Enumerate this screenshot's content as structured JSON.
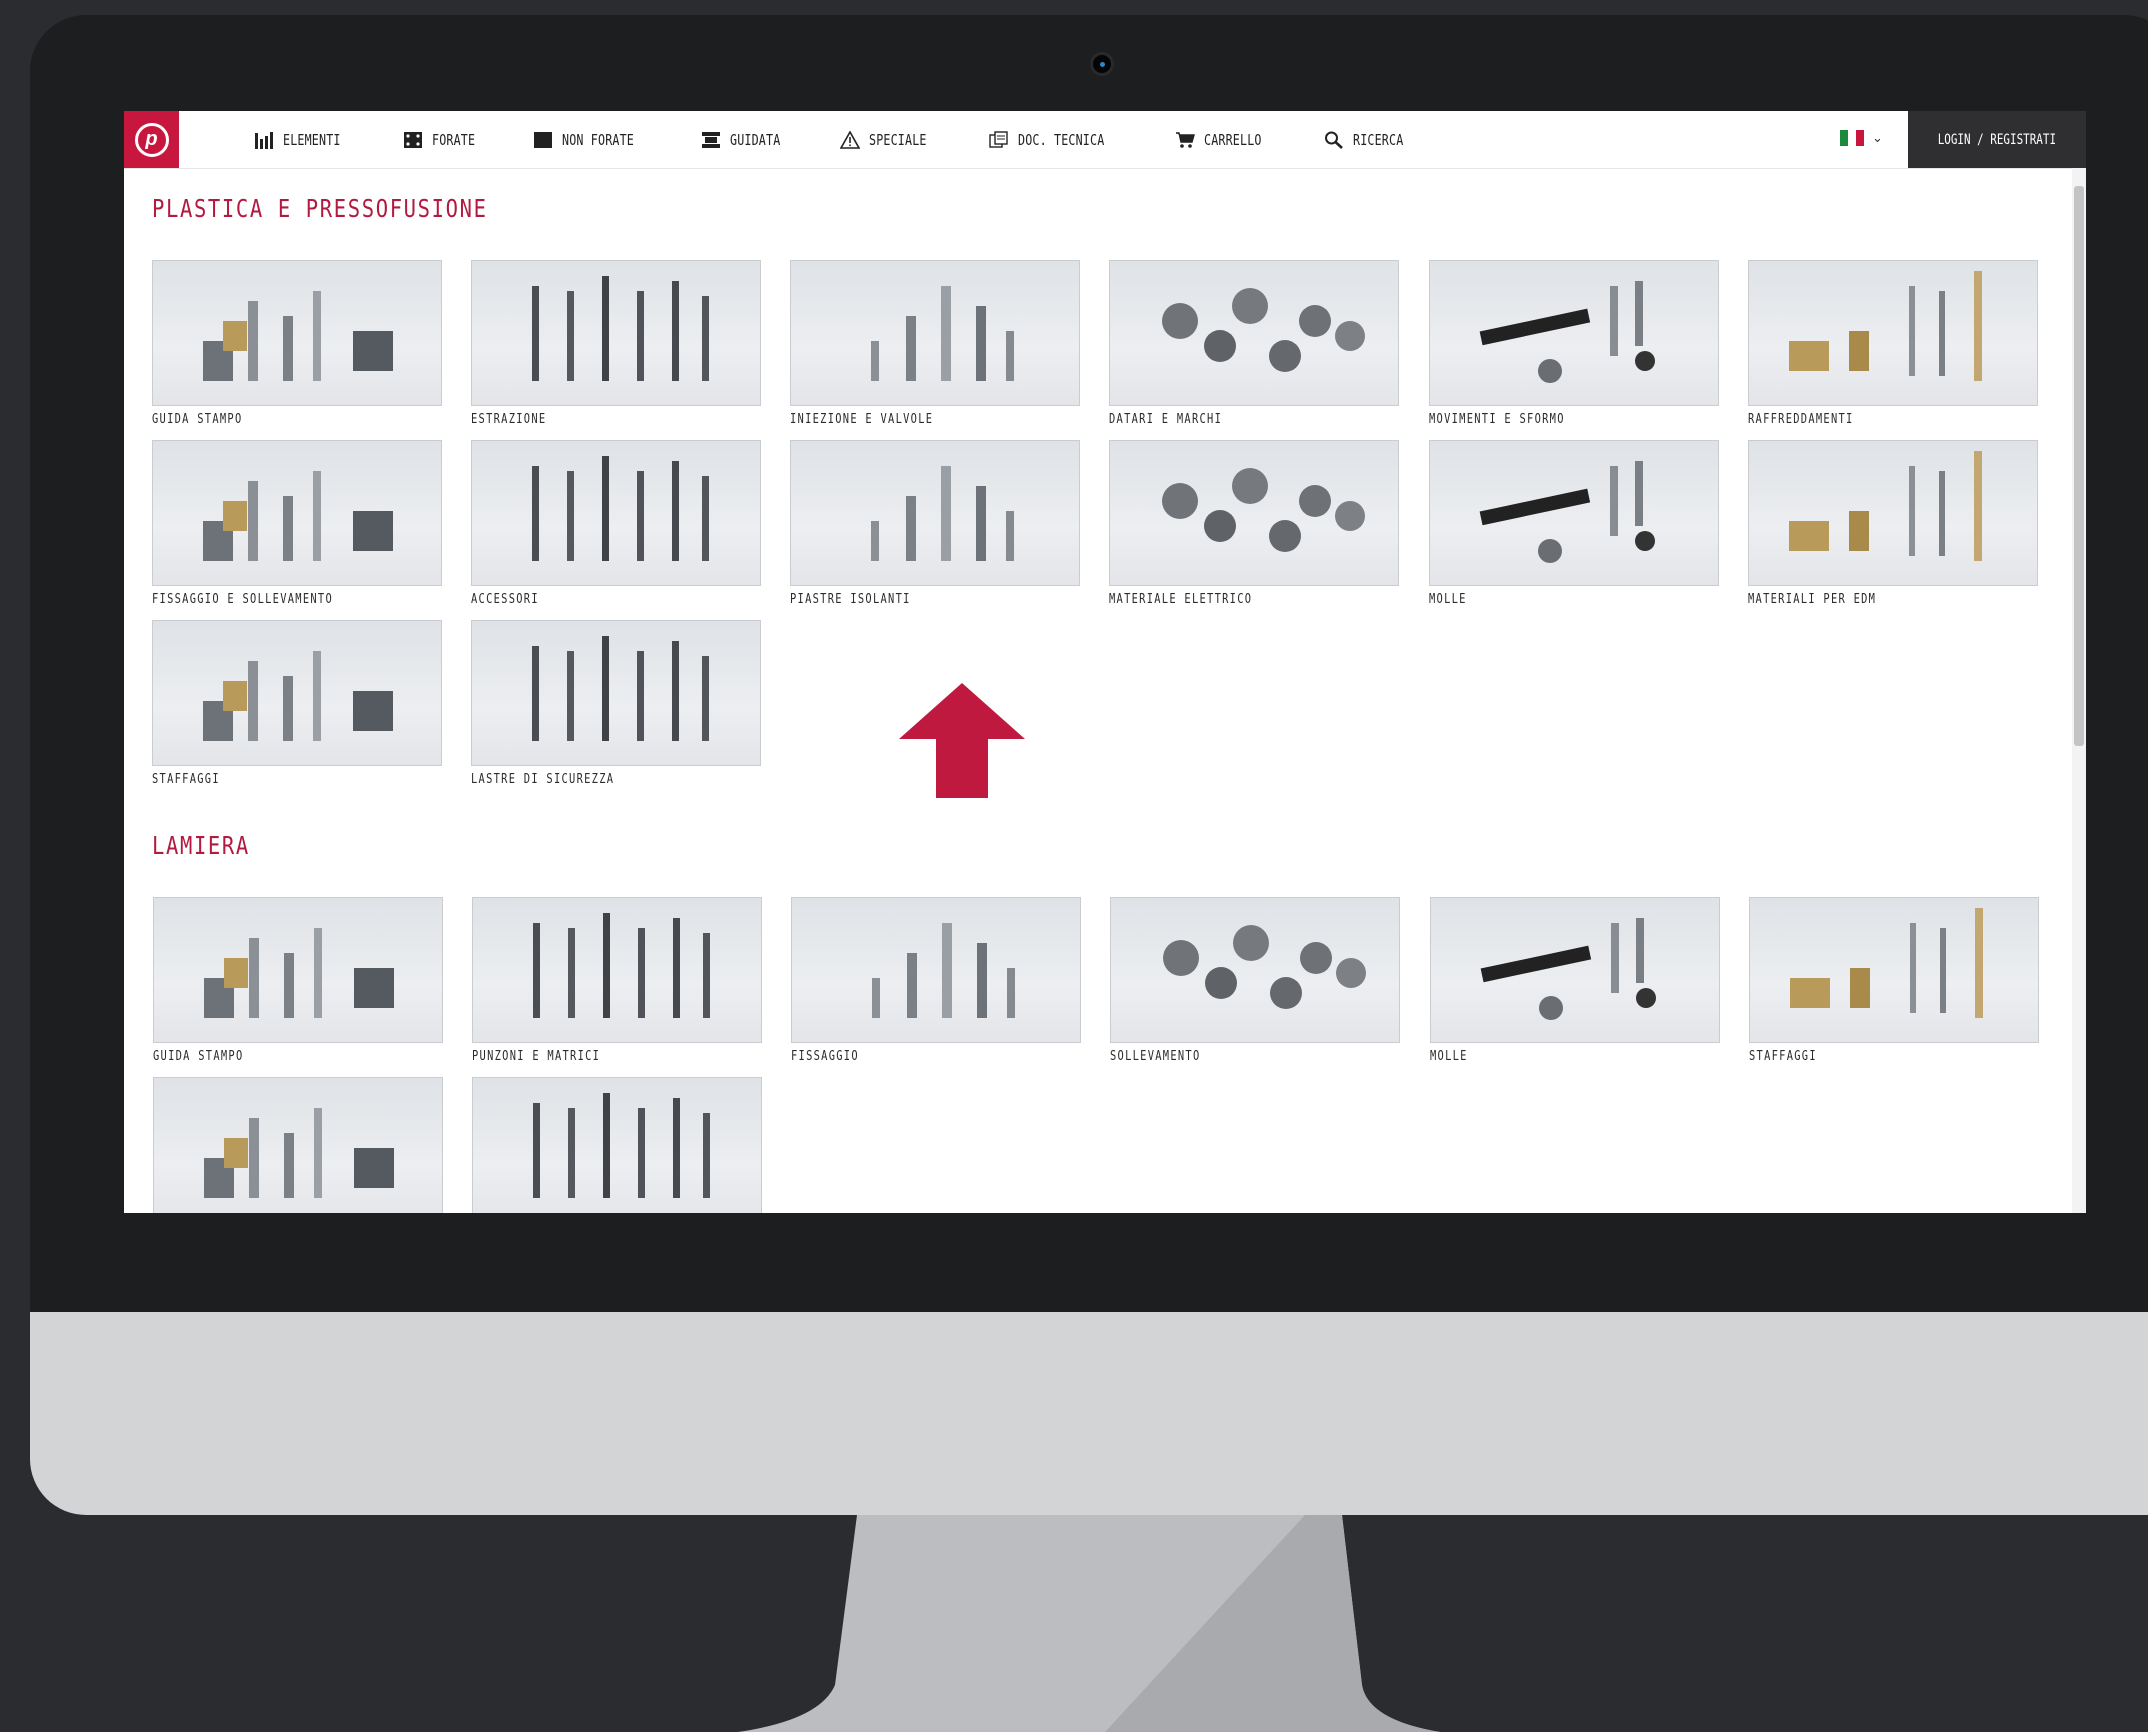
{
  "nav": {
    "items": [
      {
        "label": "ELEMENTI",
        "icon": "bar-chart-icon"
      },
      {
        "label": "FORATE",
        "icon": "perforated-plate-icon"
      },
      {
        "label": "NON FORATE",
        "icon": "solid-plate-icon"
      },
      {
        "label": "GUIDATA",
        "icon": "guided-plate-icon"
      },
      {
        "label": "SPECIALE",
        "icon": "warning-triangle-icon"
      },
      {
        "label": "DOC. TECNICA",
        "icon": "documents-icon"
      },
      {
        "label": "CARRELLO",
        "icon": "cart-icon"
      },
      {
        "label": "RICERCA",
        "icon": "search-icon"
      }
    ],
    "language_flag": "italian-flag-icon",
    "login_label": "LOGIN / REGISTRATI"
  },
  "colors": {
    "brand": "#c8173f",
    "title": "#b21a40",
    "login_bg": "#2f2f31"
  },
  "sections": [
    {
      "title": "PLASTICA E PRESSOFUSIONE",
      "tiles": [
        "GUIDA STAMPO",
        "ESTRAZIONE",
        "INIEZIONE E VALVOLE",
        "DATARI E MARCHI",
        "MOVIMENTI E SFORMO",
        "RAFFREDDAMENTI",
        "FISSAGGIO E SOLLEVAMENTO",
        "ACCESSORI",
        "PIASTRE ISOLANTI",
        "MATERIALE ELETTRICO",
        "MOLLE",
        "MATERIALI PER EDM",
        "STAFFAGGI",
        "LASTRE DI SICUREZZA"
      ]
    },
    {
      "title": "LAMIERA",
      "tiles": [
        "GUIDA STAMPO",
        "PUNZONI E MATRICI",
        "FISSAGGIO",
        "SOLLEVAMENTO",
        "MOLLE",
        "STAFFAGGI",
        "",
        ""
      ]
    }
  ]
}
